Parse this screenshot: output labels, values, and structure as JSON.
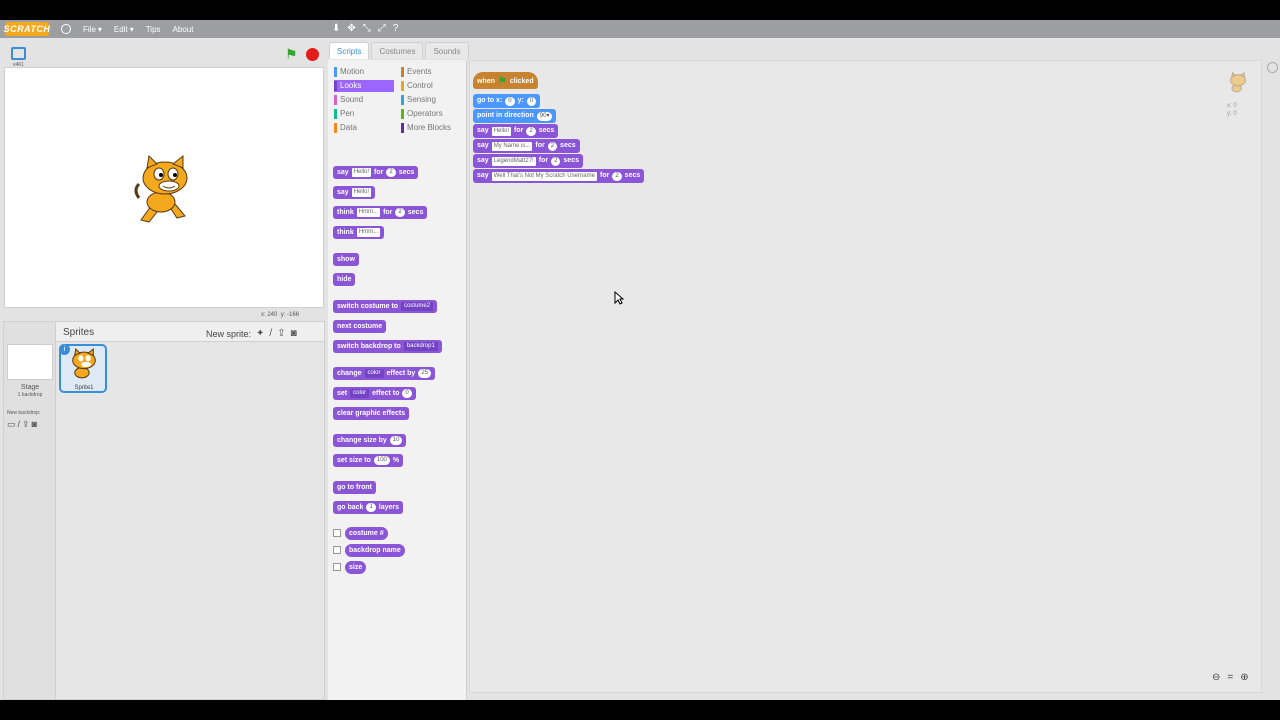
{
  "menubar": {
    "logo": "SCRATCH",
    "menus": [
      {
        "label": "File",
        "arrow": "▾"
      },
      {
        "label": "Edit",
        "arrow": "▾"
      },
      {
        "label": "Tips",
        "arrow": ""
      },
      {
        "label": "About",
        "arrow": ""
      }
    ],
    "tools": [
      "⬇",
      "✥",
      "⤡",
      "⤢",
      "?"
    ]
  },
  "stage": {
    "version": "v461",
    "coords_x_label": "x:",
    "coords_x": "240",
    "coords_y_label": "y:",
    "coords_y": "-166"
  },
  "sprites": {
    "title": "Sprites",
    "new_sprite_label": "New sprite:",
    "stage_label": "Stage",
    "stage_backdrops": "1 backdrop",
    "new_backdrop_label": "New backdrop:",
    "sprite_name": "Sprite1",
    "info": "i"
  },
  "tabs": [
    "Scripts",
    "Costumes",
    "Sounds"
  ],
  "categories": {
    "left": [
      {
        "label": "Motion",
        "color": "#4c97ff"
      },
      {
        "label": "Looks",
        "color": "#9a66ff"
      },
      {
        "label": "Sound",
        "color": "#cf63cf"
      },
      {
        "label": "Pen",
        "color": "#0fbd8c"
      },
      {
        "label": "Data",
        "color": "#ff8c1a"
      }
    ],
    "right": [
      {
        "label": "Events",
        "color": "#c88330"
      },
      {
        "label": "Control",
        "color": "#e6a822"
      },
      {
        "label": "Sensing",
        "color": "#2ca5e2"
      },
      {
        "label": "Operators",
        "color": "#5cb712"
      },
      {
        "label": "More Blocks",
        "color": "#632d99"
      }
    ]
  },
  "palette": {
    "say_for": {
      "say": "say",
      "text": "Hello!",
      "for": "for",
      "secs_value": "2",
      "secs": "secs"
    },
    "say": {
      "say": "say",
      "text": "Hello!"
    },
    "think_for": {
      "think": "think",
      "text": "Hmm...",
      "for": "for",
      "secs_value": "2",
      "secs": "secs"
    },
    "think": {
      "think": "think",
      "text": "Hmm..."
    },
    "show": "show",
    "hide": "hide",
    "switch_costume": {
      "label": "switch costume to",
      "value": "costume2"
    },
    "next_costume": "next costume",
    "switch_backdrop": {
      "label": "switch backdrop to",
      "value": "backdrop1"
    },
    "change_effect": {
      "change": "change",
      "effect": "color",
      "by": "effect by",
      "value": "25"
    },
    "set_effect": {
      "set": "set",
      "effect": "color",
      "to": "effect to",
      "value": "0"
    },
    "clear_effects": "clear graphic effects",
    "change_size": {
      "label": "change size by",
      "value": "10"
    },
    "set_size": {
      "label": "set size to",
      "value": "100",
      "unit": "%"
    },
    "go_front": "go to front",
    "go_back": {
      "label": "go back",
      "value": "1",
      "unit": "layers"
    },
    "reporters": [
      "costume #",
      "backdrop name",
      "size"
    ]
  },
  "script": {
    "hat": {
      "when": "when",
      "clicked": "clicked"
    },
    "goto": {
      "label": "go to x:",
      "x": "0",
      "y_label": "y:",
      "y": "0"
    },
    "point": {
      "label": "point in direction",
      "value": "90▾"
    },
    "lines": [
      {
        "say": "say",
        "text": "Hello!",
        "for": "for",
        "secs_value": "2",
        "secs": "secs"
      },
      {
        "say": "say",
        "text": "My Name is...",
        "for": "for",
        "secs_value": "2",
        "secs": "secs"
      },
      {
        "say": "say",
        "text": "LegendMatt27!",
        "for": "for",
        "secs_value": "2",
        "secs": "secs"
      },
      {
        "say": "say",
        "text": "Well That's Not My Scratch Username",
        "for": "for",
        "secs_value": "2",
        "secs": "secs"
      }
    ],
    "sprite_x": "x: 0",
    "sprite_y": "y: 0"
  },
  "zoom": {
    "out": "🔍",
    "reset": "=",
    "in": "🔍"
  }
}
